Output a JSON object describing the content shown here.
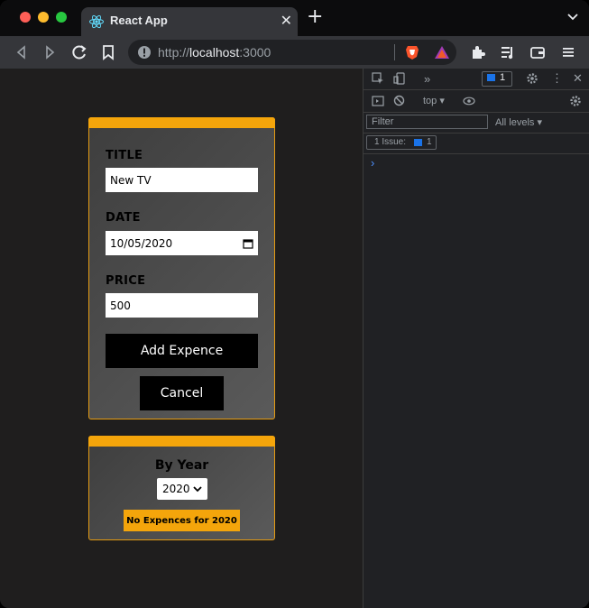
{
  "browser": {
    "tab_title": "React App",
    "url_prefix": "http://",
    "url_host": "localhost",
    "url_port": ":3000",
    "traffic_colors": {
      "close": "#ff5f57",
      "minimize": "#febc2e",
      "maximize": "#28c840"
    }
  },
  "form": {
    "title_label": "TITLE",
    "title_value": "New TV",
    "date_label": "DATE",
    "date_value": "10/05/2020",
    "price_label": "PRICE",
    "price_value": "500",
    "submit_label": "Add Expence",
    "cancel_label": "Cancel"
  },
  "filter": {
    "heading": "By Year",
    "selected_year": "2020",
    "empty_message": "No Expences for 2020"
  },
  "devtools": {
    "issue_count_badge": "1",
    "context": "top",
    "filter_placeholder": "Filter",
    "levels": "All levels",
    "issues_label": "1 Issue:",
    "issues_count": "1",
    "prompt": "›"
  },
  "colors": {
    "accent": "#f4a50b",
    "card_border": "#e49b12",
    "page_bg": "#1f1e1e",
    "button_bg": "#000000"
  }
}
